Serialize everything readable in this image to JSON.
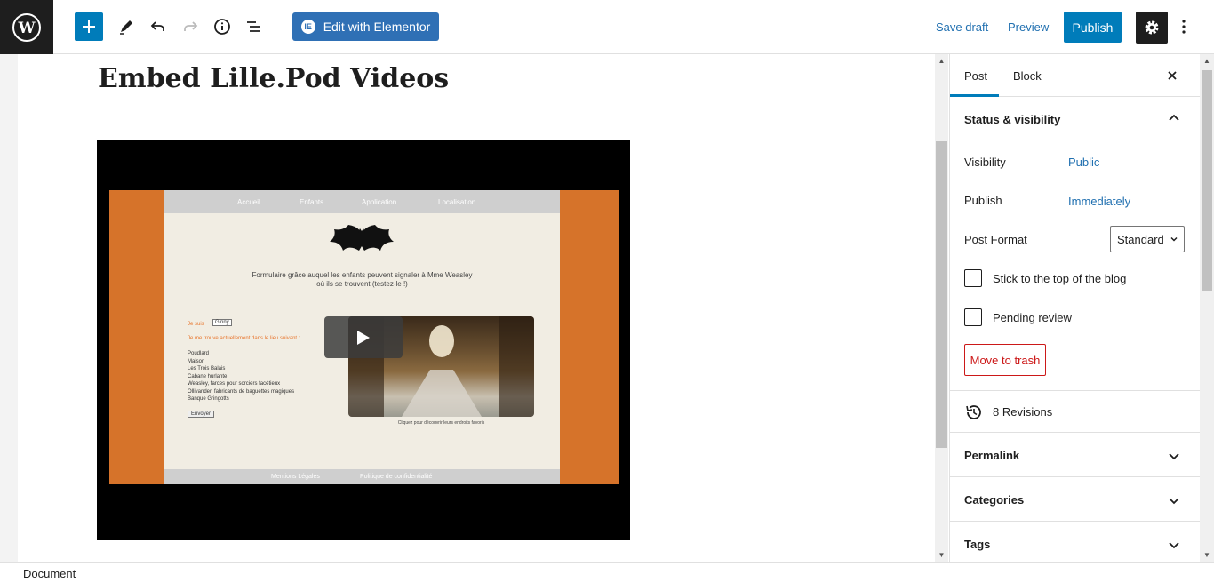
{
  "toolbar": {
    "elementor_label": "Edit with Elementor",
    "elementor_badge": "IE",
    "save_draft": "Save draft",
    "preview": "Preview",
    "publish": "Publish"
  },
  "post": {
    "title": "Embed Lille.Pod Videos"
  },
  "video": {
    "nav": [
      "Accueil",
      "Enfants",
      "Application",
      "Localisation"
    ],
    "description_line1": "Formulaire grâce auquel les enfants peuvent signaler à Mme Weasley",
    "description_line2": "où ils se trouvent (testez-le !)",
    "form_label_1": "Je suis",
    "form_select": "Ginny",
    "form_label_2": "Je me trouve actuellement dans le lieu suivant :",
    "places": [
      "Poudlard",
      "Maison",
      "Les Trois Balais",
      "Cabane hurlante",
      "Weasley, farces pour sorciers facétieux",
      "Ollivander, fabricants de baguettes magiques",
      "Banque Gringotts"
    ],
    "submit": "Envoyer",
    "photo_caption": "Cliquez pour découvrir leurs endroits favoris",
    "footer_left": "Mentions Légales",
    "footer_right": "Politique de confidentialité"
  },
  "sidebar": {
    "tab_post": "Post",
    "tab_block": "Block",
    "status_heading": "Status & visibility",
    "visibility_label": "Visibility",
    "visibility_value": "Public",
    "publish_label": "Publish",
    "publish_value": "Immediately",
    "format_label": "Post Format",
    "format_value": "Standard",
    "stick_label": "Stick to the top of the blog",
    "pending_label": "Pending review",
    "trash": "Move to trash",
    "revisions": "8 Revisions",
    "permalink": "Permalink",
    "categories": "Categories",
    "tags": "Tags"
  },
  "footer": {
    "breadcrumb": "Document"
  },
  "colors": {
    "accent": "#007cba",
    "elementor": "#2f70b5",
    "danger": "#cc1818",
    "link": "#2271b1"
  }
}
